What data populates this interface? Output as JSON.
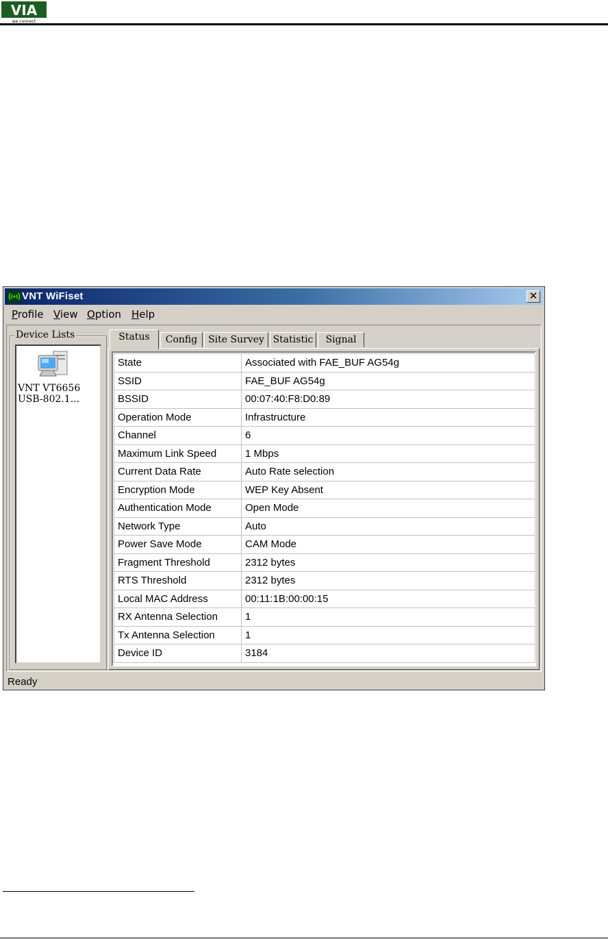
{
  "document": {
    "logo_text": "VIA",
    "logo_tagline": "we connect"
  },
  "window": {
    "title": "VNT WiFiset",
    "close_glyph": "✕",
    "menu": [
      "Profile",
      "View",
      "Option",
      "Help"
    ],
    "status_bar": "Ready"
  },
  "device_list": {
    "label": "Device Lists",
    "devices": [
      {
        "name_line1": "VNT VT6656",
        "name_line2": "USB-802.1..."
      }
    ]
  },
  "tabs": [
    "Status",
    "Config",
    "Site Survey",
    "Statistic",
    "Signal"
  ],
  "active_tab": "Status",
  "status": [
    {
      "label": "State",
      "value": "Associated with FAE_BUF AG54g"
    },
    {
      "label": "SSID",
      "value": "FAE_BUF AG54g"
    },
    {
      "label": "BSSID",
      "value": "00:07:40:F8:D0:89"
    },
    {
      "label": "Operation Mode",
      "value": "Infrastructure"
    },
    {
      "label": "Channel",
      "value": "6"
    },
    {
      "label": "Maximum Link Speed",
      "value": "1 Mbps"
    },
    {
      "label": "Current Data Rate",
      "value": "Auto Rate selection"
    },
    {
      "label": "Encryption Mode",
      "value": "WEP Key Absent"
    },
    {
      "label": "Authentication Mode",
      "value": "Open Mode"
    },
    {
      "label": "Network Type",
      "value": "Auto"
    },
    {
      "label": "Power Save Mode",
      "value": "CAM Mode"
    },
    {
      "label": "Fragment Threshold",
      "value": "2312 bytes"
    },
    {
      "label": "RTS Threshold",
      "value": "2312 bytes"
    },
    {
      "label": "Local MAC Address",
      "value": "00:11:1B:00:00:15"
    },
    {
      "label": "RX Antenna Selection",
      "value": "1"
    },
    {
      "label": "Tx Antenna Selection",
      "value": "1"
    },
    {
      "label": "Device ID",
      "value": "3184"
    }
  ],
  "colors": {
    "titlebar_start": "#0a246a",
    "titlebar_end": "#a6caf0",
    "window_face": "#d4d0c8",
    "logo_green": "#2e7d32"
  }
}
